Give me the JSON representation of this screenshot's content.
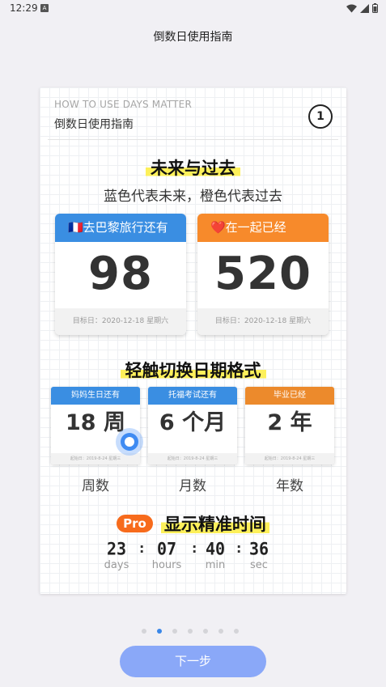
{
  "status_bar": {
    "time": "12:29",
    "notification_letter": "A"
  },
  "page_title": "倒数日使用指南",
  "card": {
    "eng_title": "HOW TO USE DAYS MATTER",
    "cn_title": "倒数日使用指南",
    "step": "1"
  },
  "section1": {
    "title": "未来与过去",
    "subtitle": "蓝色代表未来，橙色代表过去",
    "cards": [
      {
        "head": "🇫🇷去巴黎旅行还有",
        "number": "98",
        "footer": "目标日：2020-12-18 星期六",
        "color": "#3a8ee2"
      },
      {
        "head": "❤️在一起已经",
        "number": "520",
        "footer": "目标日：2020-12-18 星期六",
        "color": "#f78a2b"
      }
    ]
  },
  "section2": {
    "title": "轻触切换日期格式",
    "cards": [
      {
        "head": "妈妈生日还有",
        "number": "18 周",
        "footer": "起始日：2019-8-24 星期三",
        "label": "周数",
        "color": "#3a8ee2"
      },
      {
        "head": "托福考试还有",
        "number": "6 个月",
        "footer": "起始日：2019-8-24 星期三",
        "label": "月数",
        "color": "#3a8ee2"
      },
      {
        "head": "毕业已经",
        "number": "2 年",
        "footer": "起始日：2019-8-24 星期三",
        "label": "年数",
        "color": "#ec8a2c"
      }
    ]
  },
  "section3": {
    "badge": "Pro",
    "title": "显示精准时间",
    "timer": [
      {
        "value": "23",
        "unit": "days"
      },
      {
        "value": "07",
        "unit": "hours"
      },
      {
        "value": "40",
        "unit": "min"
      },
      {
        "value": "36",
        "unit": "sec"
      }
    ]
  },
  "pager": {
    "count": 7,
    "active_index": 1
  },
  "next_button": "下一步"
}
